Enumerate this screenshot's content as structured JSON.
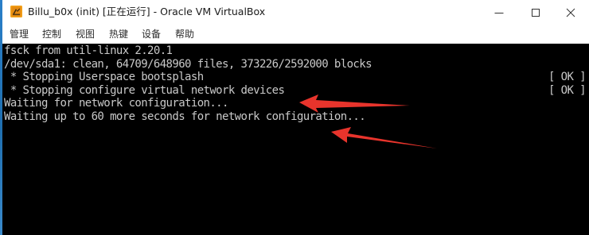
{
  "window": {
    "title": "Billu_b0x (init) [正在运行] - Oracle VM VirtualBox",
    "icon": "virtualbox-icon"
  },
  "menu": {
    "items": [
      {
        "label": "管理"
      },
      {
        "label": "控制"
      },
      {
        "label": "视图"
      },
      {
        "label": "热键"
      },
      {
        "label": "设备"
      },
      {
        "label": "帮助"
      }
    ]
  },
  "console": {
    "lines": [
      {
        "text": "fsck from util-linux 2.20.1",
        "status": ""
      },
      {
        "text": "/dev/sda1: clean, 64709/648960 files, 373226/2592000 blocks",
        "status": ""
      },
      {
        "text": " * Stopping Userspace bootsplash",
        "status": "[ OK ]"
      },
      {
        "text": " * Stopping configure virtual network devices",
        "status": "[ OK ]"
      },
      {
        "text": "Waiting for network configuration...",
        "status": ""
      },
      {
        "text": "Waiting up to 60 more seconds for network configuration...",
        "status": ""
      }
    ]
  },
  "annotations": {
    "arrow_color": "#e8342c",
    "arrows": [
      "red-arrow",
      "red-arrow"
    ]
  }
}
